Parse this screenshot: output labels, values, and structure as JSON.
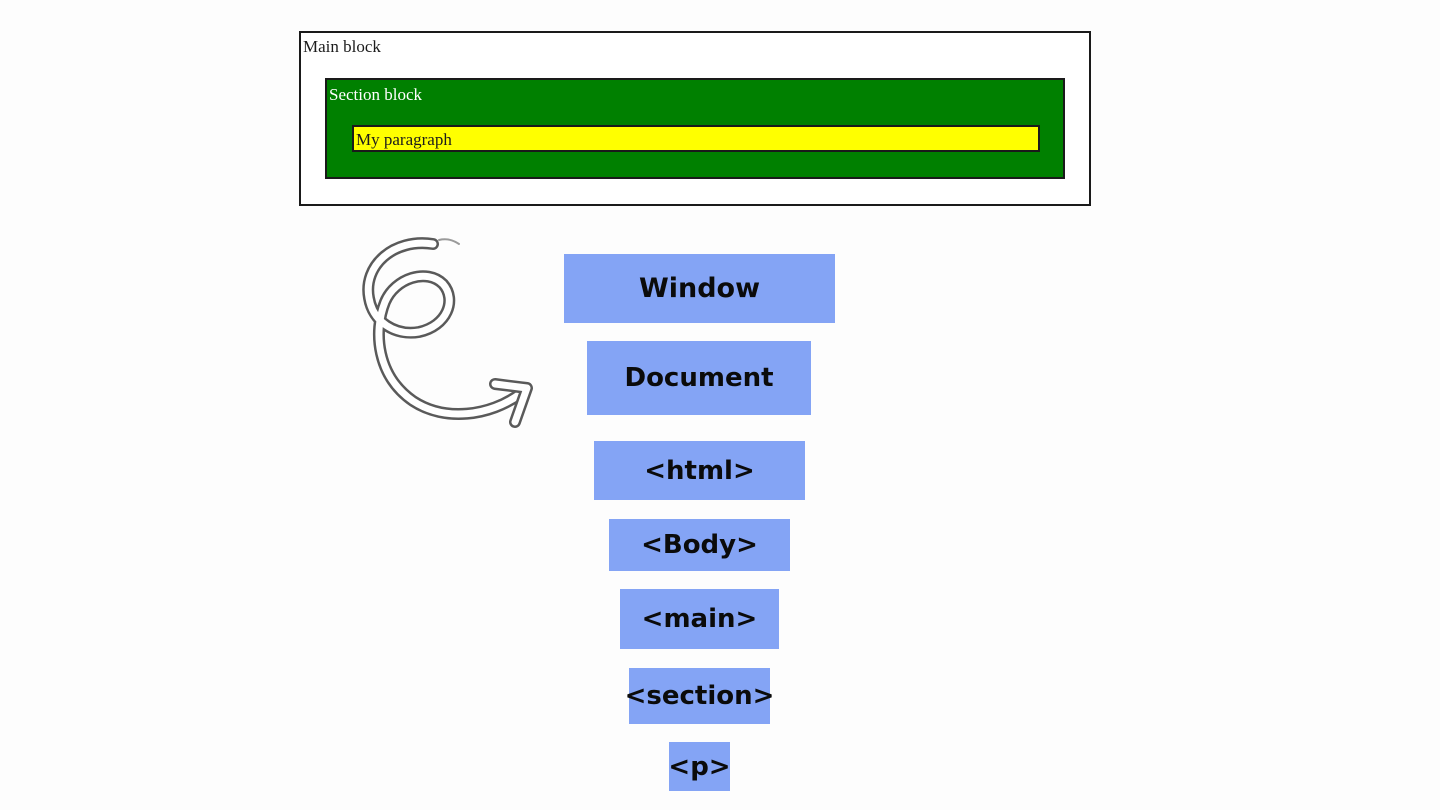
{
  "demo": {
    "main_label": "Main block",
    "section_label": "Section block",
    "paragraph_label": "My paragraph",
    "colors": {
      "main_bg": "#ffffff",
      "section_bg": "#008000",
      "paragraph_bg": "#ffff00"
    }
  },
  "arrow_icon": "curly-arrow-icon",
  "hierarchy": {
    "color": "#84a4f5",
    "levels": [
      {
        "label": "Window"
      },
      {
        "label": "Document"
      },
      {
        "label": "<html>"
      },
      {
        "label": "<Body>"
      },
      {
        "label": "<main>"
      },
      {
        "label": "<section>"
      },
      {
        "label": "<p>"
      }
    ]
  }
}
